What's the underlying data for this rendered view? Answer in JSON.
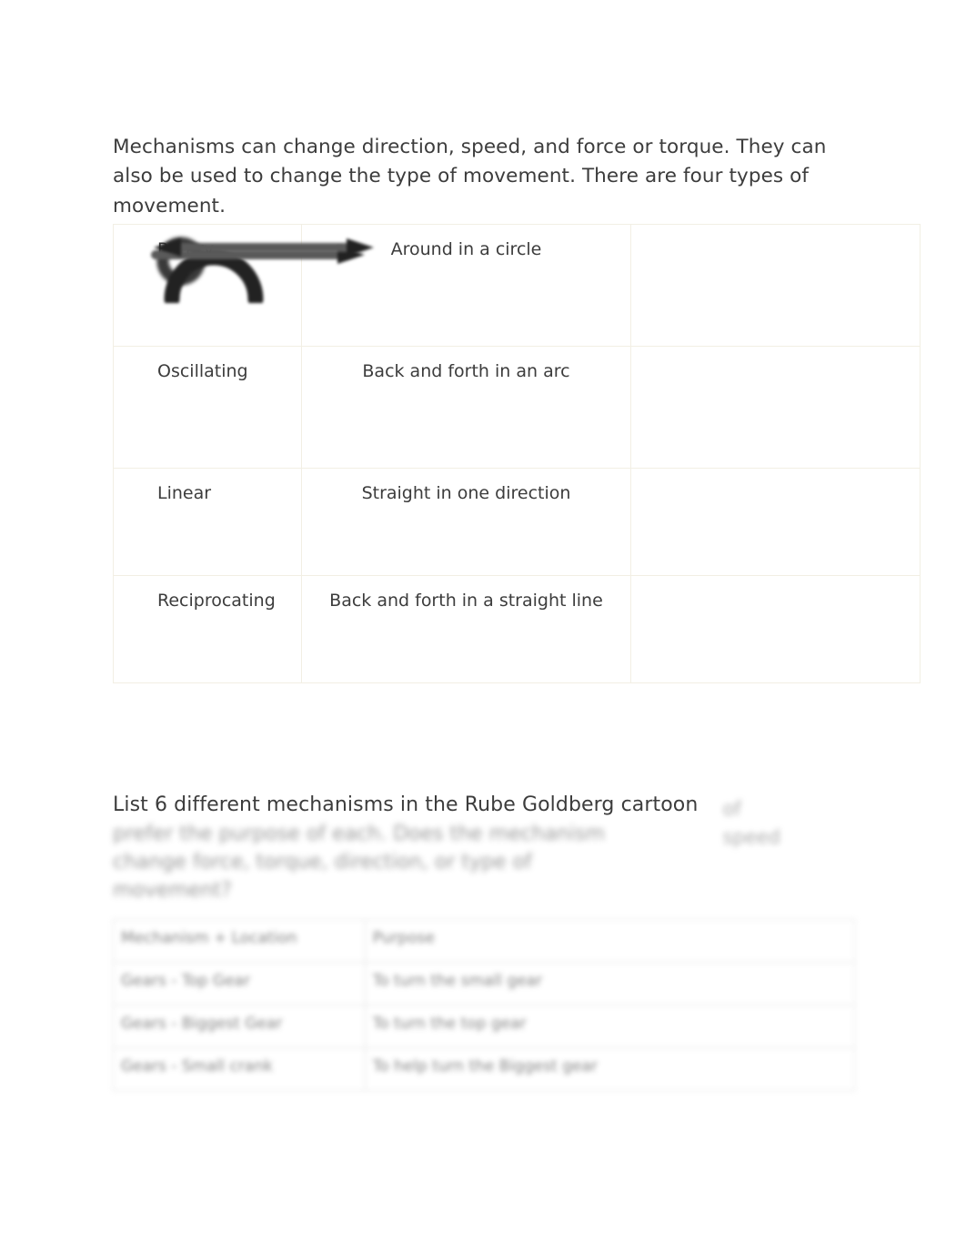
{
  "document": {
    "intro_paragraph": "Mechanisms can change direction, speed, and force or torque. They can also be used to change the type of movement. There are four types of movement."
  },
  "movement_table": {
    "rows": [
      {
        "type": "Rotary",
        "description": "Around in a circle",
        "icon": "circular-arrow-icon"
      },
      {
        "type": "Oscillating",
        "description": "Back and forth in an arc",
        "icon": "arc-arrow-icon"
      },
      {
        "type": "Linear",
        "description": "Straight in one direction",
        "icon": "single-arrow-icon"
      },
      {
        "type": "Reciprocating",
        "description": "Back and forth in a straight line",
        "icon": "double-arrow-icon"
      }
    ]
  },
  "question": {
    "heading_line_1": "List 6 different mechanisms in the Rube Goldberg cartoon",
    "heading_blurred_lines": "prefer the purpose of each. Does the mechanism change force, torque, direction, or type of movement?",
    "heading_right_fragment_1": "of",
    "heading_right_fragment_2": "speed"
  },
  "mechanisms_table": {
    "headers": [
      "Mechanism + Location",
      "Purpose"
    ],
    "rows": [
      [
        "Gears - Top Gear",
        "To turn the small gear"
      ],
      [
        "Gears - Biggest Gear",
        "To turn the top gear"
      ],
      [
        "Gears - Small crank",
        "To help turn the Biggest gear"
      ]
    ]
  },
  "colors": {
    "text": "#3c3c3c",
    "table1_border": "#f2efe4",
    "table2_border": "#d8d8d8",
    "icon": "#2b2b2b",
    "page_background": "#ffffff"
  }
}
